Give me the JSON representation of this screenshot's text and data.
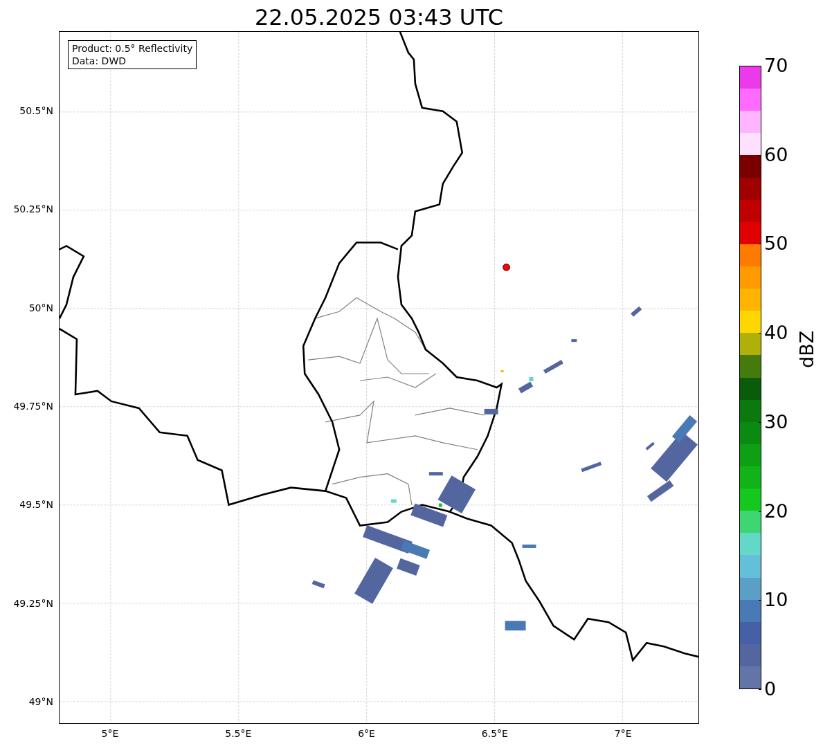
{
  "title": "22.05.2025 03:43 UTC",
  "info_box": {
    "lines": [
      "Product: 0.5° Reflectivity",
      "Data: DWD"
    ]
  },
  "map": {
    "yticks": [
      "50.5°N",
      "50.25°N",
      "50°N",
      "49.75°N",
      "49.5°N",
      "49.25°N",
      "49°N"
    ],
    "xticks": [
      "5°E",
      "5.5°E",
      "6°E",
      "6.5°E",
      "7°E"
    ]
  },
  "colorbar": {
    "label": "dBZ",
    "ticks": [
      "70",
      "60",
      "50",
      "40",
      "30",
      "20",
      "10",
      "0"
    ],
    "segments": [
      {
        "color": "#ea3aea"
      },
      {
        "color": "#ff6aff"
      },
      {
        "color": "#ffb4ff"
      },
      {
        "color": "#ffe0ff"
      },
      {
        "color": "#7a0000"
      },
      {
        "color": "#a00000"
      },
      {
        "color": "#c00000"
      },
      {
        "color": "#e00000"
      },
      {
        "color": "#ff7b00"
      },
      {
        "color": "#ff9a00"
      },
      {
        "color": "#ffb400"
      },
      {
        "color": "#ffd700"
      },
      {
        "color": "#b0b00a"
      },
      {
        "color": "#457a0c"
      },
      {
        "color": "#0a5c0a"
      },
      {
        "color": "#0a7a10"
      },
      {
        "color": "#0b8a12"
      },
      {
        "color": "#0ea014"
      },
      {
        "color": "#10b418"
      },
      {
        "color": "#14c81e"
      },
      {
        "color": "#3dd672"
      },
      {
        "color": "#64d8c6"
      },
      {
        "color": "#64c0da"
      },
      {
        "color": "#5a9fc8"
      },
      {
        "color": "#4a7ab5"
      },
      {
        "color": "#4560a5"
      },
      {
        "color": "#5466a0"
      },
      {
        "color": "#6374a8"
      }
    ]
  }
}
